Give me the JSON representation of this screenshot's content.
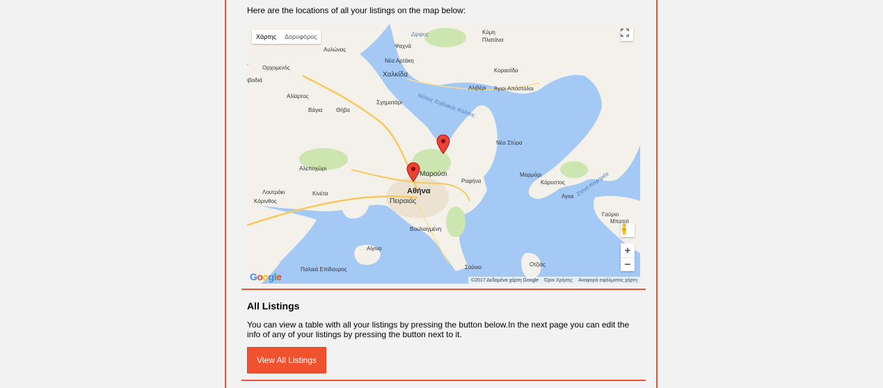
{
  "intro_text": "Here are the locations of all your listings on the map below:",
  "map": {
    "type_buttons": [
      "Χάρτης",
      "Δορυφόρος"
    ],
    "attribution": "©2017 Δεδομένα χάρτη Google",
    "terms": "Όροι Χρήσης",
    "report": "Αναφορά σφάλματος χάρτη",
    "google_logo": "Google",
    "zoom_in": "+",
    "zoom_out": "−",
    "places": {
      "athens": "Αθήνα",
      "piraeus": "Πειραιάς",
      "marousi": "Μαρούσι",
      "chalkida": "Χαλκίδα",
      "thiva": "Θήβα",
      "vagia": "Βάγια",
      "aliartos": "Αλίαρτος",
      "orchomenos": "Ορχομενός",
      "livadia": "ιβαδιά",
      "alepochori": "Αλεποχώρι",
      "loutraki": "Λουτράκι",
      "korinthos": "Κόρινθος",
      "kineta": "Κινέτα",
      "rafina": "Ραφήνα",
      "vouliagmeni": "Βουλιαγμένη",
      "aigina": "Αίγινα",
      "nea_styra": "Νέα Στύρα",
      "marmari": "Μαρμάρι",
      "karystos": "Κάρυστος",
      "aliveri": "Αλιβέρι",
      "agioi_apostoloi": "Άγιοι Απόστολοι",
      "kymi": "Κύμη",
      "platana": "Πλατάνα",
      "korasida": "Κορασίδα",
      "psachna": "Ψαχνά",
      "nea_artaki": "Νέα Αρτάκη",
      "avlonas": "Αυλώνας",
      "schimatari": "Σχηματάρι",
      "dirfys": "Δίρφυς",
      "sounio": "Σούνιο",
      "otzias": "Οτζιάς",
      "gavrio": "Γαύριο",
      "mpatsi": "Μπατσί",
      "aigoi": "Αγιοι",
      "palaia_epidavros": "Παλαιά Επίδαυρος",
      "north_euboean": "Νότιος Ευβοϊκός Κόλπος",
      "kafireas": "Στενό Καφηρέα"
    }
  },
  "all_listings": {
    "heading": "All Listings",
    "description": "You can view a table with all your listings by pressing the button below.In the next page you can edit the info of any of your listings by pressing the button next to it.",
    "button_label": "View All Listings"
  },
  "colors": {
    "accent": "#f0522f",
    "sea": "#a4c9f5",
    "land": "#f3f1ea",
    "park": "#cde5b0"
  }
}
